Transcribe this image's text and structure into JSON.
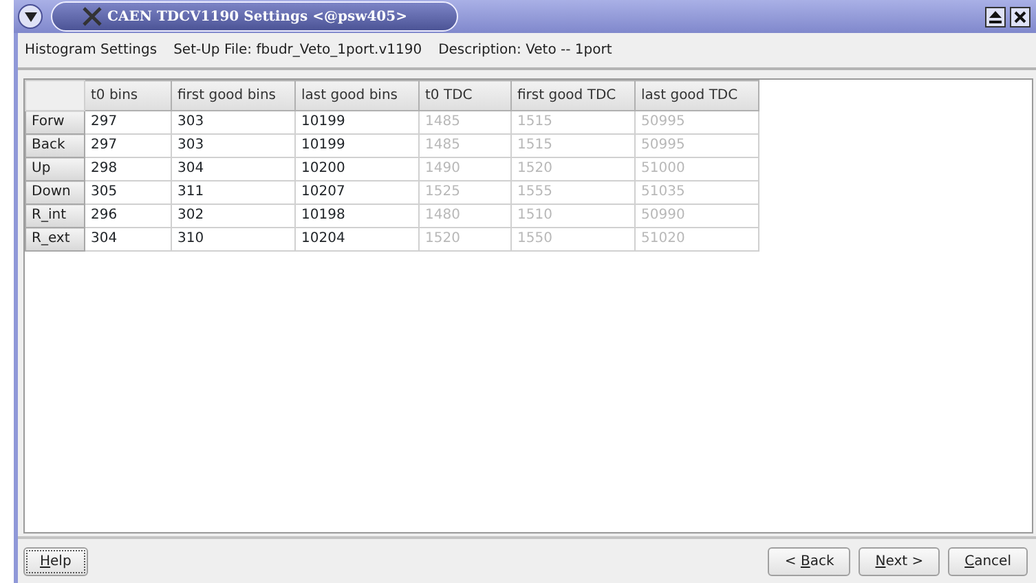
{
  "window": {
    "title": "CAEN TDCV1190 Settings <@psw405>"
  },
  "header": [
    "Histogram Settings",
    "Set-Up File: fbudr_Veto_1port.v1190",
    "Description: Veto -- 1port"
  ],
  "table": {
    "columns": [
      {
        "label": "t0 bins",
        "editable": true
      },
      {
        "label": "first good bins",
        "editable": true
      },
      {
        "label": "last good bins",
        "editable": true
      },
      {
        "label": "t0 TDC",
        "editable": false
      },
      {
        "label": "first good TDC",
        "editable": false
      },
      {
        "label": "last good TDC",
        "editable": false
      }
    ],
    "rows": [
      {
        "label": "Forw",
        "cells": [
          "297",
          "303",
          "10199",
          "1485",
          "1515",
          "50995"
        ]
      },
      {
        "label": "Back",
        "cells": [
          "297",
          "303",
          "10199",
          "1485",
          "1515",
          "50995"
        ]
      },
      {
        "label": "Up",
        "cells": [
          "298",
          "304",
          "10200",
          "1490",
          "1520",
          "51000"
        ]
      },
      {
        "label": "Down",
        "cells": [
          "305",
          "311",
          "10207",
          "1525",
          "1555",
          "51035"
        ]
      },
      {
        "label": "R_int",
        "cells": [
          "296",
          "302",
          "10198",
          "1480",
          "1510",
          "50990"
        ]
      },
      {
        "label": "R_ext",
        "cells": [
          "304",
          "310",
          "10204",
          "1520",
          "1550",
          "51020"
        ]
      }
    ]
  },
  "left_buttons": [
    {
      "label_parts": [
        {
          "text": "H",
          "underline": true
        },
        {
          "text": "elp",
          "underline": false
        }
      ],
      "focused": true
    }
  ],
  "right_buttons": [
    {
      "label_parts": [
        {
          "text": "< ",
          "underline": false
        },
        {
          "text": "B",
          "underline": true
        },
        {
          "text": "ack",
          "underline": false
        }
      ],
      "focused": false
    },
    {
      "label_parts": [
        {
          "text": "N",
          "underline": true
        },
        {
          "text": "ext >",
          "underline": false
        }
      ],
      "focused": false
    },
    {
      "label_parts": [
        {
          "text": "C",
          "underline": true
        },
        {
          "text": "ancel",
          "underline": false
        }
      ],
      "focused": false
    }
  ]
}
